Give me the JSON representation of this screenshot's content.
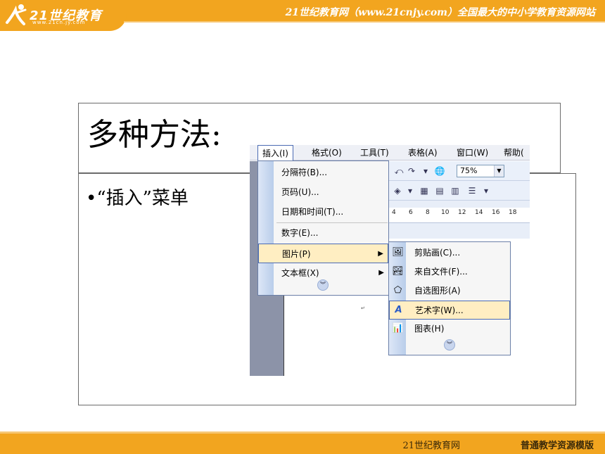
{
  "header": {
    "logo_text": "21世纪教育",
    "logo_url": "www.21cn.jy.com",
    "slogan": "21世纪教育网（www.21cnjy.com）全国最大的中小学教育资源网站"
  },
  "slide": {
    "title": "多种方法:",
    "bullet": "•“插入”菜单"
  },
  "word_window": {
    "menu_bar": [
      "插入(I)",
      "格式(O)",
      "工具(T)",
      "表格(A)",
      "窗口(W)",
      "帮助("
    ],
    "active_menu": "插入(I)",
    "zoom": "75%",
    "ruler_numbers": [
      "4",
      "6",
      "8",
      "10",
      "12",
      "14",
      "16",
      "18"
    ],
    "insert_menu": {
      "items": [
        "分隔符(B)...",
        "页码(U)...",
        "日期和时间(T)...",
        "数字(E)...",
        "图片(P)",
        "文本框(X)"
      ],
      "highlighted": "图片(P)"
    },
    "picture_submenu": {
      "items": [
        {
          "label": "剪贴画(C)...",
          "icon": "clipart-icon"
        },
        {
          "label": "来自文件(F)...",
          "icon": "image-file-icon"
        },
        {
          "label": "自选图形(A)",
          "icon": "autoshape-icon"
        },
        {
          "label": "艺术字(W)...",
          "icon": "wordart-icon"
        },
        {
          "label": "图表(H)",
          "icon": "chart-icon"
        }
      ],
      "highlighted": "艺术字(W)..."
    }
  },
  "footer": {
    "site": "21世纪教育网",
    "template": "普通教学资源模版"
  },
  "colors": {
    "band": "#f2a51f",
    "menu_highlight": "#ffeec2",
    "menu_border": "#4b6bb3"
  }
}
